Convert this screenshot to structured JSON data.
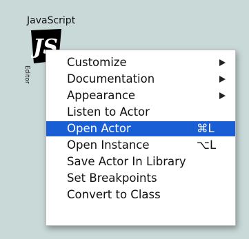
{
  "actor": {
    "title": "JavaScript",
    "icon": "javascript-icon",
    "icon_text": "JS",
    "subtitle": "Editor"
  },
  "context_menu": {
    "highlight_color": "#1a5ed6",
    "items": [
      {
        "label": "Customize",
        "submenu": true,
        "shortcut": ""
      },
      {
        "label": "Documentation",
        "submenu": true,
        "shortcut": ""
      },
      {
        "label": "Appearance",
        "submenu": true,
        "shortcut": ""
      },
      {
        "label": "Listen to Actor",
        "submenu": false,
        "shortcut": ""
      },
      {
        "label": "Open Actor",
        "submenu": false,
        "shortcut": "⌘L",
        "highlighted": true
      },
      {
        "label": "Open Instance",
        "submenu": false,
        "shortcut": "⌥L"
      },
      {
        "label": "Save Actor In Library",
        "submenu": false,
        "shortcut": ""
      },
      {
        "label": "Set Breakpoints",
        "submenu": false,
        "shortcut": ""
      },
      {
        "label": "Convert to Class",
        "submenu": false,
        "shortcut": ""
      }
    ]
  }
}
